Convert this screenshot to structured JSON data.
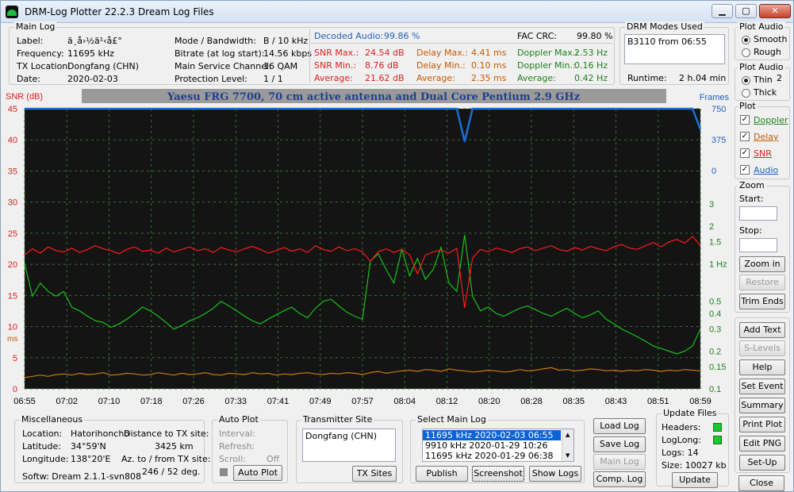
{
  "window": {
    "title": "DRM-Log Plotter 22.2.3   Dream Log Files",
    "min": "▭",
    "max": "▢",
    "close": "✕"
  },
  "main_log": {
    "title": "Main Log",
    "label_k": "Label:",
    "label_v": "ä¸­å›½ä¹‹å£°",
    "freq_k": "Frequency:",
    "freq_v": "11695   kHz",
    "tx_k": "TX Location:",
    "tx_v": "Dongfang (CHN)",
    "date_k": "Date:",
    "date_v": "2020-02-03",
    "mode_k": "Mode / Bandwidth:",
    "mode_v": "B / 10 kHz",
    "bitrate_k": "Bitrate (at log start):",
    "bitrate_v": "14.56 kbps",
    "msc_k": "Main Service Channel:",
    "msc_v": "16  QAM",
    "prot_k": "Protection Level:",
    "prot_v": "1 / 1",
    "dec_k": "Decoded Audio:",
    "dec_v": "99.86 %",
    "fac_k": "FAC  CRC:",
    "fac_v": "99.80 %",
    "snrmax_k": "SNR Max.:",
    "snrmax_v": "24.54  dB",
    "snrmin_k": "SNR Min.:",
    "snrmin_v": "8.76  dB",
    "snravg_k": "Average:",
    "snravg_v": "21.62  dB",
    "delmax_k": "Delay Max.:",
    "delmax_v": "4.41    ms",
    "delmin_k": "Delay Min.:",
    "delmin_v": "0.10    ms",
    "delavg_k": "Average:",
    "delavg_v": "2.35    ms",
    "dopmax_k": "Doppler Max.:",
    "dopmax_v": "2.53 Hz",
    "dopmin_k": "Doppler Min.:",
    "dopmin_v": "0.16 Hz",
    "dopavg_k": "Average:",
    "dopavg_v": "0.42 Hz"
  },
  "drm_modes": {
    "title": "DRM Modes Used",
    "text": "B3110 from 06:55",
    "runtime_k": "Runtime:",
    "runtime_v": "2 h.04 min"
  },
  "plot_audio1": {
    "title": "Plot Audio",
    "smooth": "Smooth",
    "rough": "Rough"
  },
  "plot_audio2": {
    "title": "Plot Audio",
    "thin": "Thin",
    "thick": "Thick",
    "num": "2"
  },
  "plot_opts": {
    "title": "Plot",
    "doppler": "Doppler",
    "delay": "Delay",
    "snr": "SNR",
    "audio": "Audio"
  },
  "zoom": {
    "title": "Zoom",
    "start": "Start:",
    "stop": "Stop:",
    "zoomin": "Zoom in",
    "restore": "Restore",
    "trim": "Trim Ends"
  },
  "side_buttons": {
    "addtext": "Add Text",
    "slevels": "S-Levels",
    "help": "Help",
    "setevent": "Set Event",
    "summary": "Summary",
    "printplot": "Print Plot",
    "editpng": "Edit PNG",
    "setup": "Set-Up",
    "close": "Close"
  },
  "chart_data": {
    "type": "line",
    "title": "Yaesu FRG 7700, 70 cm active antenna and Dual Core Pentium 2.9 GHz",
    "ylabel_left": "SNR (dB)",
    "ylabel_left2": "ms",
    "ylabel_right": "Frames",
    "y_left_ticks": [
      "45",
      "40",
      "35",
      "30",
      "25",
      "20",
      "15",
      "10",
      "5",
      "0"
    ],
    "y_right_blue": [
      "750",
      "375",
      "0"
    ],
    "y_right_green": [
      "3",
      "2",
      "1.5",
      "1 Hz",
      "0.5",
      "0.4",
      "0.3",
      "0.2",
      "0.15",
      "0.1"
    ],
    "x_ticks": [
      "06:55",
      "07:02",
      "07:10",
      "07:18",
      "07:26",
      "07:33",
      "07:41",
      "07:49",
      "07:57",
      "08:04",
      "08:12",
      "08:20",
      "08:28",
      "08:35",
      "08:43",
      "08:51",
      "08:59"
    ],
    "series": [
      {
        "name": "SNR",
        "color": "#ff1a1a",
        "values": [
          21.5,
          22.5,
          21.8,
          22.8,
          22.2,
          22.0,
          22.6,
          21.9,
          22.4,
          23.0,
          22.5,
          22.2,
          21.7,
          22.4,
          22.8,
          22.1,
          22.3,
          21.8,
          22.6,
          22.0,
          22.4,
          22.8,
          22.2,
          22.5,
          21.9,
          22.7,
          22.3,
          22.0,
          22.5,
          22.9,
          22.4,
          21.8,
          22.2,
          22.7,
          22.1,
          22.5,
          21.9,
          23.0,
          22.4,
          22.1,
          22.8,
          22.2,
          22.5,
          22.0,
          20.5,
          22.0,
          22.5,
          21.9,
          22.4,
          21.5,
          18.5,
          21.5,
          22.0,
          22.3,
          21.8,
          22.6,
          13.0,
          21.0,
          22.4,
          22.0,
          22.6,
          22.3,
          21.9,
          22.5,
          22.8,
          22.2,
          22.6,
          23.0,
          22.4,
          22.1,
          22.7,
          22.3,
          22.9,
          22.5,
          22.2,
          22.8,
          23.2,
          22.6,
          22.4,
          23.0,
          23.5,
          22.8,
          23.6,
          24.0,
          23.4,
          24.5,
          23.0
        ]
      },
      {
        "name": "Doppler",
        "color": "#18c018",
        "values": [
          1.0,
          0.55,
          0.7,
          0.6,
          0.55,
          0.6,
          0.45,
          0.42,
          0.38,
          0.35,
          0.34,
          0.31,
          0.33,
          0.36,
          0.4,
          0.45,
          0.42,
          0.38,
          0.34,
          0.3,
          0.32,
          0.35,
          0.37,
          0.4,
          0.44,
          0.5,
          0.46,
          0.42,
          0.38,
          0.35,
          0.33,
          0.36,
          0.39,
          0.42,
          0.45,
          0.4,
          0.37,
          0.44,
          0.5,
          0.52,
          0.46,
          0.41,
          0.38,
          0.36,
          1.05,
          1.2,
          0.9,
          0.7,
          1.3,
          0.8,
          1.1,
          0.75,
          0.9,
          1.35,
          0.7,
          0.6,
          1.7,
          0.55,
          0.42,
          0.45,
          0.4,
          0.38,
          0.41,
          0.44,
          0.46,
          0.43,
          0.4,
          0.38,
          0.41,
          0.44,
          0.4,
          0.37,
          0.39,
          0.42,
          0.36,
          0.33,
          0.3,
          0.28,
          0.26,
          0.24,
          0.22,
          0.21,
          0.2,
          0.19,
          0.2,
          0.22,
          0.3
        ]
      },
      {
        "name": "Delay",
        "color": "#c97a10",
        "values": [
          1.8,
          2.0,
          2.2,
          2.0,
          2.3,
          2.4,
          2.2,
          2.5,
          2.3,
          2.4,
          2.6,
          2.2,
          2.3,
          2.5,
          2.4,
          2.2,
          2.3,
          2.6,
          2.4,
          2.2,
          2.5,
          2.3,
          2.4,
          2.6,
          2.3,
          2.2,
          2.5,
          2.4,
          2.3,
          2.6,
          2.4,
          2.5,
          2.2,
          2.4,
          2.3,
          2.5,
          2.6,
          2.4,
          2.3,
          2.5,
          2.4,
          2.6,
          2.5,
          2.3,
          2.6,
          2.8,
          2.5,
          2.7,
          2.9,
          3.0,
          2.8,
          3.1,
          3.0,
          2.8,
          3.2,
          3.0,
          2.9,
          2.7,
          2.8,
          3.0,
          2.9,
          2.7,
          2.8,
          3.1,
          2.9,
          3.0,
          3.2,
          3.4,
          3.0,
          3.1,
          2.9,
          3.0,
          3.2,
          3.1,
          2.9,
          3.0,
          2.8,
          3.0,
          2.9,
          3.1,
          3.0,
          2.8,
          3.0,
          2.9,
          3.1,
          3.0,
          2.9
        ]
      },
      {
        "name": "Frames",
        "color": "#1a6fd8",
        "values": [
          750,
          750,
          750,
          750,
          750,
          750,
          750,
          750,
          750,
          750,
          750,
          750,
          750,
          750,
          750,
          750,
          750,
          750,
          750,
          750,
          750,
          750,
          750,
          750,
          750,
          750,
          750,
          750,
          750,
          750,
          750,
          750,
          750,
          750,
          750,
          750,
          750,
          750,
          750,
          750,
          750,
          750,
          750,
          750,
          750,
          750,
          750,
          750,
          750,
          750,
          750,
          750,
          750,
          750,
          750,
          750,
          350,
          750,
          750,
          750,
          750,
          750,
          750,
          750,
          750,
          750,
          750,
          750,
          750,
          750,
          750,
          750,
          750,
          750,
          750,
          750,
          750,
          750,
          750,
          750,
          750,
          750,
          750,
          750,
          750,
          750,
          500
        ]
      }
    ]
  },
  "misc": {
    "title": "Miscellaneous",
    "loc_k": "Location:",
    "loc_v": "Hatorihoncho",
    "lat_k": "Latitude:",
    "lat_v": "34°59'N",
    "lon_k": "Longitude:",
    "lon_v": "138°20'E",
    "dist_k": "Distance to TX site:",
    "dist_v": "3425    km",
    "az_k": "Az. to / from TX site:",
    "az_v": "246 / 52  deg.",
    "softw": "Softw: Dream 2.1.1-svn808"
  },
  "auto_plot": {
    "title": "Auto Plot",
    "interval": "Interval:",
    "refresh": "Refresh:",
    "scroll": "Scroll:",
    "scroll_v": "Off",
    "btn": "Auto Plot"
  },
  "tx_site": {
    "title": "Transmitter Site",
    "value": "Dongfang (CHN)",
    "btn": "TX Sites"
  },
  "select_log": {
    "title": "Select Main Log",
    "rows": [
      "11695 kHz  2020-02-03   06:55",
      "9910 kHz   2020-01-29   10:26",
      "11695 kHz  2020-01-29   06:38"
    ],
    "publish": "Publish",
    "screenshot": "Screenshot",
    "showlogs": "Show Logs"
  },
  "log_buttons": {
    "load": "Load Log",
    "save": "Save Log",
    "main": "Main Log",
    "comp": "Comp. Log"
  },
  "update_files": {
    "title": "Update Files",
    "headers": "Headers:",
    "loglong": "LogLong:",
    "logs": "Logs: 14",
    "size": "Size:  10027 kb",
    "btn": "Update"
  }
}
